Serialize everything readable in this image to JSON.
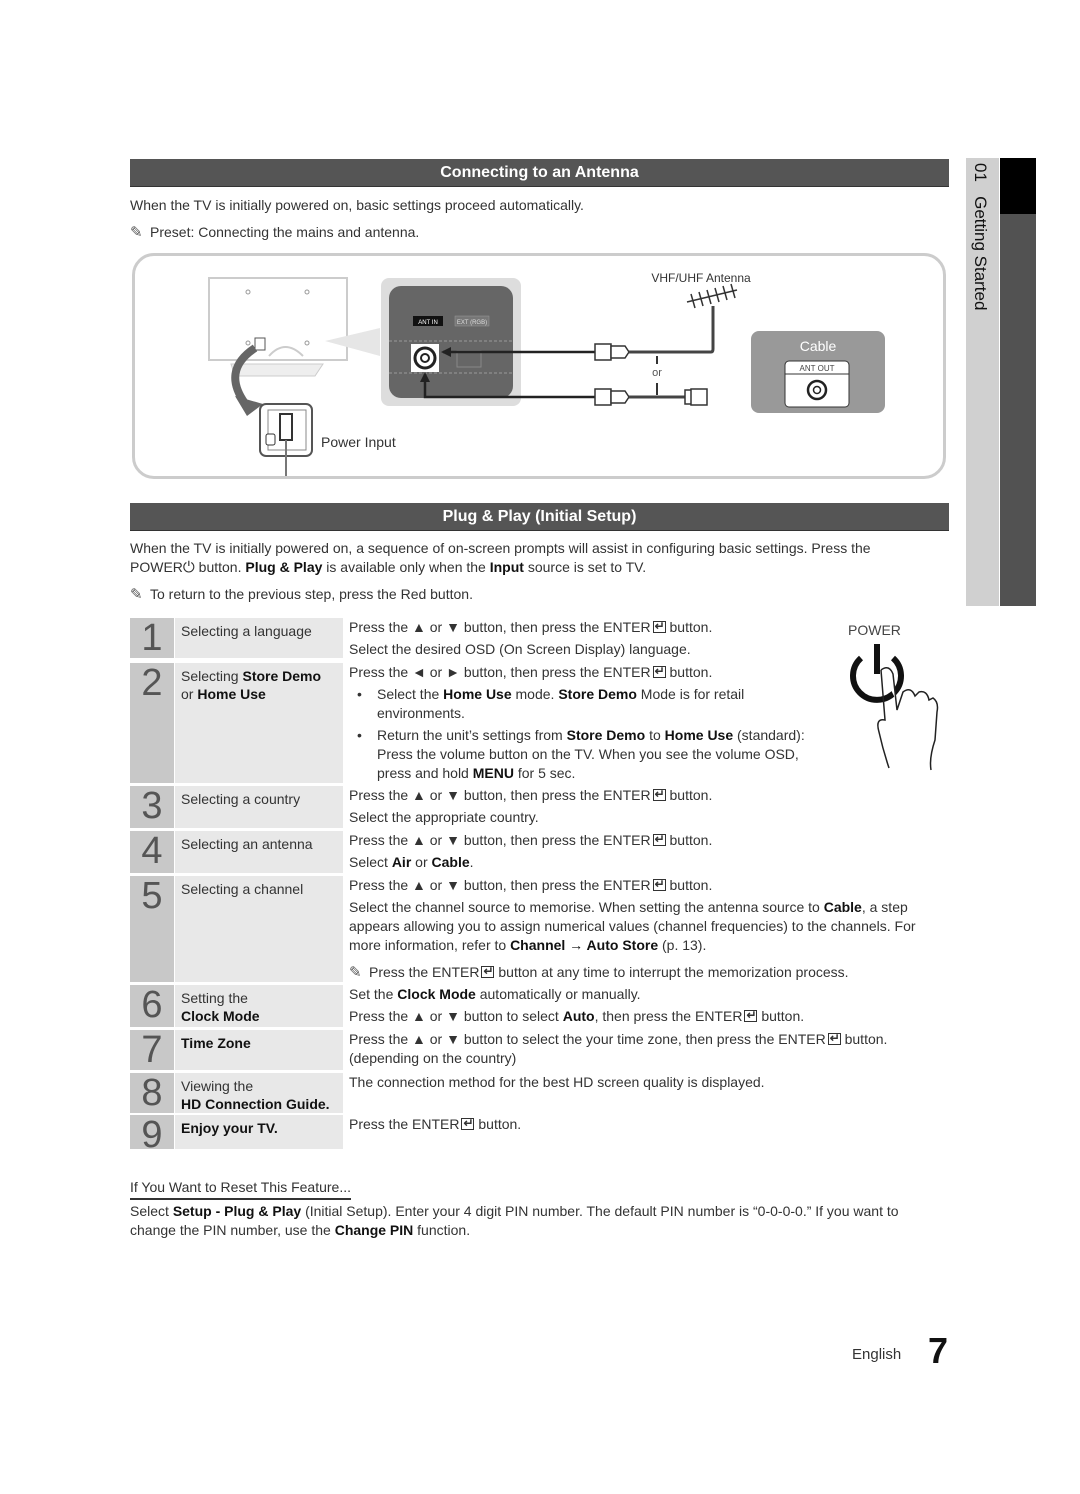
{
  "side_tab": {
    "chapter": "01",
    "title": "Getting Started"
  },
  "antenna_section": {
    "title": "Connecting to an Antenna",
    "intro": "When the TV is initially powered on, basic settings proceed automatically.",
    "note": "Preset: Connecting the mains and antenna.",
    "diagram": {
      "power_input_label": "Power Input",
      "ant_in_label": "ANT IN",
      "ext_rgb_label": "EXT (RGB)",
      "antenna_label": "VHF/UHF Antenna",
      "or_label": "or",
      "cable_label": "Cable",
      "ant_out_label": "ANT OUT"
    }
  },
  "plug_play_section": {
    "title": "Plug & Play (Initial Setup)",
    "intro_part1": "When the TV is initially powered on, a sequence of on-screen prompts will assist in configuring basic settings. Press the",
    "intro_power": "POWER",
    "intro_part2": "button.",
    "intro_bold1": "Plug & Play",
    "intro_part3": "is available only when the",
    "intro_bold2": "Input",
    "intro_part4": "source is set to TV.",
    "note": "To return to the previous step, press the Red button.",
    "power_illustration_label": "POWER"
  },
  "steps": [
    {
      "num": "1",
      "title_plain": "Selecting a language",
      "lines": [
        "Press the ▲ or ▼ button, then press the ENTER",
        "button.",
        "Select the desired OSD (On Screen Display) language."
      ]
    },
    {
      "num": "2",
      "title_plain": "Selecting",
      "title_bold1": "Store Demo",
      "title_plain2": "or",
      "title_bold2": "Home Use",
      "line1a": "Press the ◄ or ► button, then press the ENTER",
      "line1b": "button.",
      "bullets": [
        {
          "p1": "Select the",
          "b1": "Home Use",
          "p2": "mode.",
          "b2": "Store Demo",
          "p3": "Mode is for retail environments."
        },
        {
          "p1": "Return the unit’s settings from",
          "b1": "Store Demo",
          "p2": "to",
          "b2": "Home Use",
          "p3": "(standard): Press the volume button on the TV. When you see the volume OSD, press and hold",
          "b3": "MENU",
          "p4": "for 5 sec."
        }
      ]
    },
    {
      "num": "3",
      "title_plain": "Selecting a country",
      "line1a": "Press the ▲ or ▼ button, then press the ENTER",
      "line1b": "button.",
      "line2": "Select the appropriate country."
    },
    {
      "num": "4",
      "title_plain": "Selecting an antenna",
      "line1a": "Press the ▲ or ▼ button, then press the ENTER",
      "line1b": "button.",
      "line2a": "Select",
      "line2b1": "Air",
      "line2c": "or",
      "line2b2": "Cable",
      "line2d": "."
    },
    {
      "num": "5",
      "title_plain": "Selecting a channel",
      "line1a": "Press the ▲ or ▼ button, then press the ENTER",
      "line1b": "button.",
      "para_a": "Select the channel source to memorise. When setting the antenna source to",
      "para_b1": "Cable",
      "para_c": ", a step appears allowing you to assign numerical values (channel frequencies) to the channels. For more information, refer to",
      "para_b2": "Channel → Auto Store",
      "para_d": "(p. 13).",
      "note_a": "Press the ENTER",
      "note_b": "button at any time to interrupt the memorization process."
    },
    {
      "num": "6",
      "title_plain": "Setting the",
      "title_bold": "Clock Mode",
      "line1a": "Set the",
      "line1b": "Clock Mode",
      "line1c": "automatically or manually.",
      "line2a": "Press the ▲ or ▼ button to select",
      "line2b": "Auto",
      "line2c": ", then press the ENTER",
      "line2d": "button."
    },
    {
      "num": "7",
      "title_bold": "Time Zone",
      "line1a": "Press the ▲ or ▼ button to select the your time zone, then press the ENTER",
      "line1b": "button.",
      "line2": "(depending on the country)"
    },
    {
      "num": "8",
      "title_plain": "Viewing the",
      "title_bold": "HD Connection Guide.",
      "line1": "The connection method for the best HD screen quality is displayed."
    },
    {
      "num": "9",
      "title_bold": "Enjoy your TV.",
      "line1a": "Press the ENTER",
      "line1b": "button."
    }
  ],
  "reset": {
    "heading": "If You Want to Reset This Feature...",
    "p1": "Select",
    "b1": "Setup - Plug & Play",
    "p2": "(Initial Setup). Enter your 4 digit PIN number. The default PIN number is “0-0-0-0.” If you want to change the PIN number, use the",
    "b2": "Change PIN",
    "p3": "function."
  },
  "footer": {
    "language": "English",
    "page": "7"
  },
  "icons": {
    "note": "pencil-note-icon",
    "power": "power-icon",
    "enter": "enter-icon"
  }
}
